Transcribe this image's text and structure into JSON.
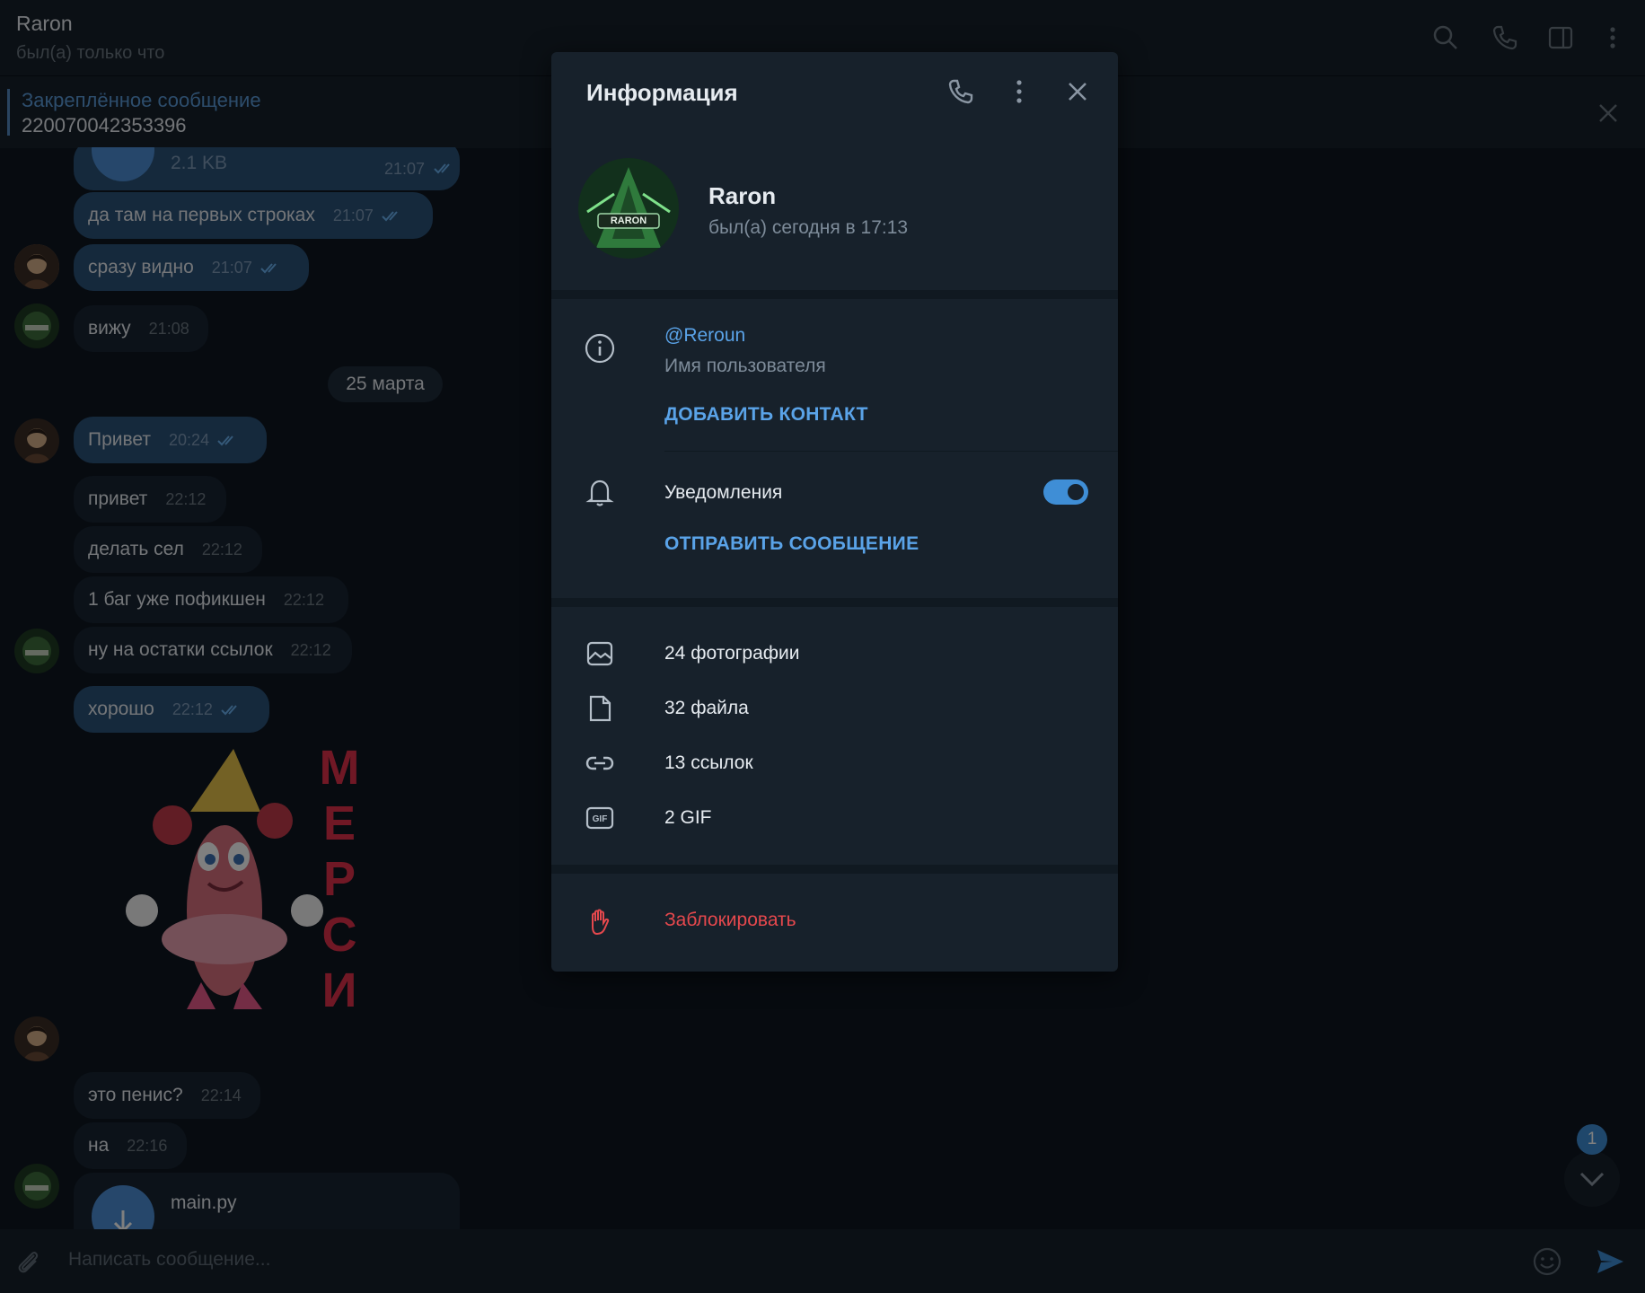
{
  "header": {
    "title": "Raron",
    "status": "был(а) только что"
  },
  "pinned": {
    "title": "Закреплённое сообщение",
    "text": "220070042353396"
  },
  "messages": [
    {
      "text": "2.1 KB",
      "time": "21:07",
      "dir": "out"
    },
    {
      "text": "да там на первых строках",
      "time": "21:07",
      "dir": "out"
    },
    {
      "text": "сразу видно",
      "time": "21:07",
      "dir": "out"
    },
    {
      "text": "вижу",
      "time": "21:08",
      "dir": "in"
    },
    {
      "text": "Привет",
      "time": "20:24",
      "dir": "out"
    },
    {
      "text": "привет",
      "time": "22:12",
      "dir": "in"
    },
    {
      "text": "делать сел",
      "time": "22:12",
      "dir": "in"
    },
    {
      "text": "1 баг уже пофикшен",
      "time": "22:12",
      "dir": "in"
    },
    {
      "text": "ну на остатки ссылок",
      "time": "22:12",
      "dir": "in"
    },
    {
      "text": "хорошо",
      "time": "22:12",
      "dir": "out"
    },
    {
      "text": "это пенис?",
      "time": "22:14",
      "dir": "in"
    },
    {
      "text": "на",
      "time": "22:16",
      "dir": "in"
    },
    {
      "text": "main.py",
      "time": "",
      "dir": "in"
    }
  ],
  "date_separator": "25 марта",
  "sticker_text": "МЕРСИ",
  "composer": {
    "placeholder": "Написать сообщение..."
  },
  "unread_count": "1",
  "panel": {
    "title": "Информация",
    "name": "Raron",
    "status": "был(а) сегодня в 17:13",
    "avatar_text": "RARON",
    "username": "@Reroun",
    "username_label": "Имя пользователя",
    "add_contact": "ДОБАВИТЬ КОНТАКТ",
    "notifications": "Уведомления",
    "notifications_on": true,
    "send_message": "ОТПРАВИТЬ СООБЩЕНИЕ",
    "media": [
      {
        "icon": "photo-icon",
        "label": "24 фотографии"
      },
      {
        "icon": "file-icon",
        "label": "32 файла"
      },
      {
        "icon": "link-icon",
        "label": "13 ссылок"
      },
      {
        "icon": "gif-icon",
        "label": "2 GIF"
      }
    ],
    "block": "Заблокировать"
  },
  "colors": {
    "background": "#0e1621",
    "panel": "#17212b",
    "accent": "#3f8ed6",
    "link": "#5aa3e8",
    "danger": "#e5484d",
    "outgoing_bubble": "#2b5278"
  }
}
